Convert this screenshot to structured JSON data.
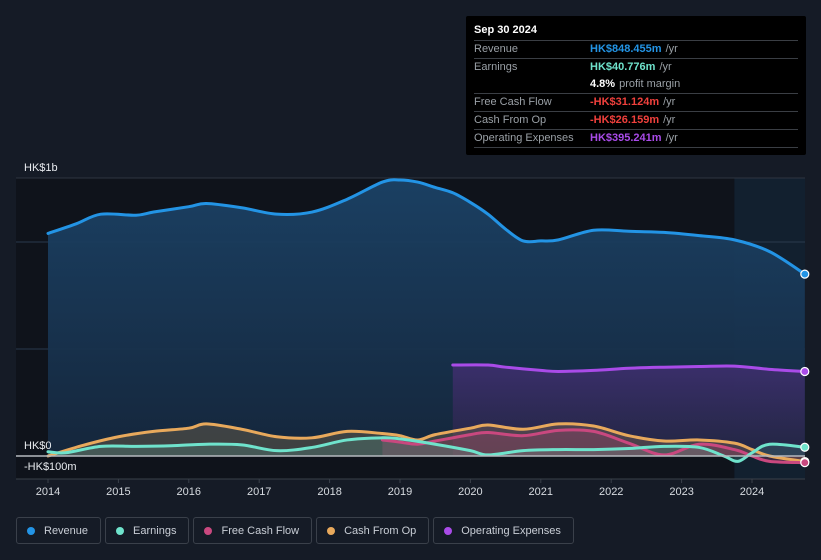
{
  "tooltip": {
    "date": "Sep 30 2024",
    "rows": [
      {
        "label": "Revenue",
        "value": "HK$848.455m",
        "unit": "/yr",
        "color": "#2394e5"
      },
      {
        "label": "Earnings",
        "value": "HK$40.776m",
        "unit": "/yr",
        "color": "#6fe3cc"
      },
      {
        "label": "",
        "margin_value": "4.8%",
        "margin_text": "profit margin"
      },
      {
        "label": "Free Cash Flow",
        "value": "-HK$31.124m",
        "unit": "/yr",
        "color": "#f0403c"
      },
      {
        "label": "Cash From Op",
        "value": "-HK$26.159m",
        "unit": "/yr",
        "color": "#f0403c"
      },
      {
        "label": "Operating Expenses",
        "value": "HK$395.241m",
        "unit": "/yr",
        "color": "#a94be8"
      }
    ]
  },
  "legend": [
    {
      "label": "Revenue",
      "color": "#2394e5"
    },
    {
      "label": "Earnings",
      "color": "#6fe3cc"
    },
    {
      "label": "Free Cash Flow",
      "color": "#c9487f"
    },
    {
      "label": "Cash From Op",
      "color": "#e8a95c"
    },
    {
      "label": "Operating Expenses",
      "color": "#a94be8"
    }
  ],
  "chart_data": {
    "type": "area",
    "title": "",
    "xlabel": "",
    "ylabel": "",
    "y_unit": "HK$ millions",
    "y_tick_labels": [
      {
        "value": 1000,
        "label": "HK$1b"
      },
      {
        "value": 0,
        "label": "HK$0"
      },
      {
        "value": -100,
        "label": "-HK$100m"
      }
    ],
    "ylim": [
      -107,
      1300
    ],
    "xlim": [
      2013.5,
      2024.75
    ],
    "x_tick_labels": [
      "2014",
      "2015",
      "2016",
      "2017",
      "2018",
      "2019",
      "2020",
      "2021",
      "2022",
      "2023",
      "2024"
    ],
    "x_ticks": [
      2014,
      2015,
      2016,
      2017,
      2018,
      2019,
      2020,
      2021,
      2022,
      2023,
      2024
    ],
    "highlight_start": 2023.75,
    "grid": true,
    "legend_position": "bottom",
    "series": [
      {
        "name": "Revenue",
        "color": "#2394e5",
        "x": [
          2014.0,
          2014.4,
          2014.75,
          2015.25,
          2015.5,
          2016.0,
          2016.25,
          2016.75,
          2017.25,
          2017.75,
          2018.25,
          2018.75,
          2019.0,
          2019.25,
          2019.5,
          2019.75,
          2020.0,
          2020.25,
          2020.5,
          2020.75,
          2021.0,
          2021.25,
          2021.75,
          2022.25,
          2022.75,
          2023.25,
          2023.75,
          2024.25,
          2024.75
        ],
        "values": [
          1040,
          1085,
          1130,
          1125,
          1140,
          1165,
          1180,
          1160,
          1130,
          1140,
          1200,
          1280,
          1290,
          1280,
          1255,
          1230,
          1185,
          1130,
          1060,
          1005,
          1005,
          1010,
          1055,
          1050,
          1045,
          1030,
          1010,
          955,
          850
        ]
      },
      {
        "name": "Earnings",
        "color": "#6fe3cc",
        "x": [
          2014.0,
          2014.25,
          2014.75,
          2015.25,
          2015.75,
          2016.25,
          2016.75,
          2017.25,
          2017.75,
          2018.25,
          2018.75,
          2019.0,
          2019.5,
          2020.0,
          2020.25,
          2020.75,
          2021.25,
          2021.75,
          2022.25,
          2022.75,
          2023.25,
          2023.6,
          2023.8,
          2024.0,
          2024.25,
          2024.75
        ],
        "values": [
          20,
          15,
          45,
          45,
          48,
          55,
          52,
          25,
          40,
          75,
          85,
          80,
          55,
          25,
          5,
          25,
          30,
          30,
          35,
          45,
          40,
          0,
          -25,
          15,
          55,
          41
        ]
      },
      {
        "name": "Free Cash Flow",
        "color": "#c9487f",
        "x": [
          2018.75,
          2019.0,
          2019.25,
          2019.5,
          2020.0,
          2020.25,
          2020.75,
          2021.25,
          2021.75,
          2022.25,
          2022.75,
          2023.25,
          2023.75,
          2024.0,
          2024.25,
          2024.75
        ],
        "values": [
          75,
          65,
          55,
          70,
          100,
          110,
          95,
          120,
          115,
          60,
          5,
          55,
          30,
          0,
          -25,
          -31
        ]
      },
      {
        "name": "Cash From Op",
        "color": "#e8a95c",
        "x": [
          2014.0,
          2014.5,
          2015.0,
          2015.5,
          2016.0,
          2016.25,
          2016.75,
          2017.25,
          2017.75,
          2018.25,
          2018.75,
          2019.0,
          2019.25,
          2019.5,
          2020.0,
          2020.25,
          2020.75,
          2021.25,
          2021.75,
          2022.25,
          2022.75,
          2023.25,
          2023.75,
          2024.0,
          2024.25,
          2024.75
        ],
        "values": [
          0,
          50,
          90,
          115,
          130,
          150,
          125,
          90,
          85,
          115,
          105,
          95,
          75,
          100,
          130,
          145,
          125,
          150,
          140,
          95,
          70,
          75,
          60,
          30,
          0,
          -26
        ]
      },
      {
        "name": "Operating Expenses",
        "color": "#a94be8",
        "x": [
          2019.75,
          2020.25,
          2020.5,
          2021.0,
          2021.25,
          2021.75,
          2022.25,
          2022.75,
          2023.25,
          2023.75,
          2024.25,
          2024.75
        ],
        "values": [
          425,
          425,
          415,
          400,
          395,
          400,
          410,
          415,
          418,
          420,
          405,
          395
        ]
      }
    ]
  }
}
